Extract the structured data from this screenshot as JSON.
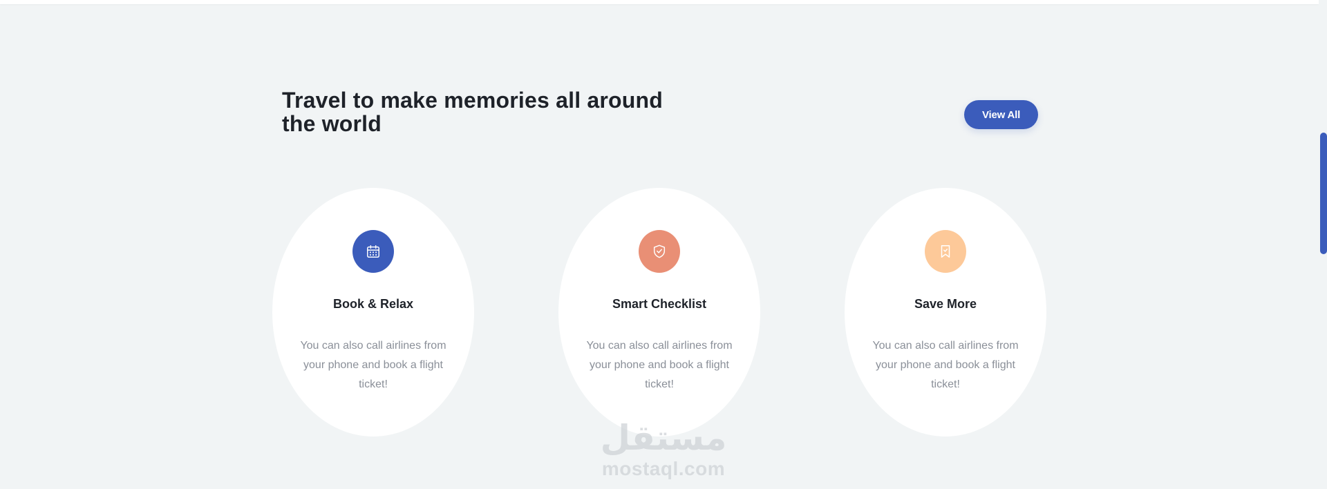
{
  "section": {
    "heading": "Travel to make memories all around the world",
    "view_all_label": "View All"
  },
  "cards": [
    {
      "title": "Book & Relax",
      "text": "You can also call airlines from your phone and book a flight ticket!",
      "icon": "calendar-icon",
      "icon_color": "#3b5cbb"
    },
    {
      "title": "Smart Checklist",
      "text": "You can also call airlines from your phone and book a flight ticket!",
      "icon": "shield-check-icon",
      "icon_color": "#e98f75"
    },
    {
      "title": "Save More",
      "text": "You can also call airlines from your phone and book a flight ticket!",
      "icon": "bookmark-icon",
      "icon_color": "#fdc999"
    }
  ],
  "watermark": {
    "arabic": "مستقل",
    "latin": "mostaql.com"
  },
  "colors": {
    "accent": "#3b5cbb",
    "background": "#f1f4f5",
    "card": "#ffffff",
    "heading_text": "#1e2229",
    "body_text": "#8a8f98"
  }
}
